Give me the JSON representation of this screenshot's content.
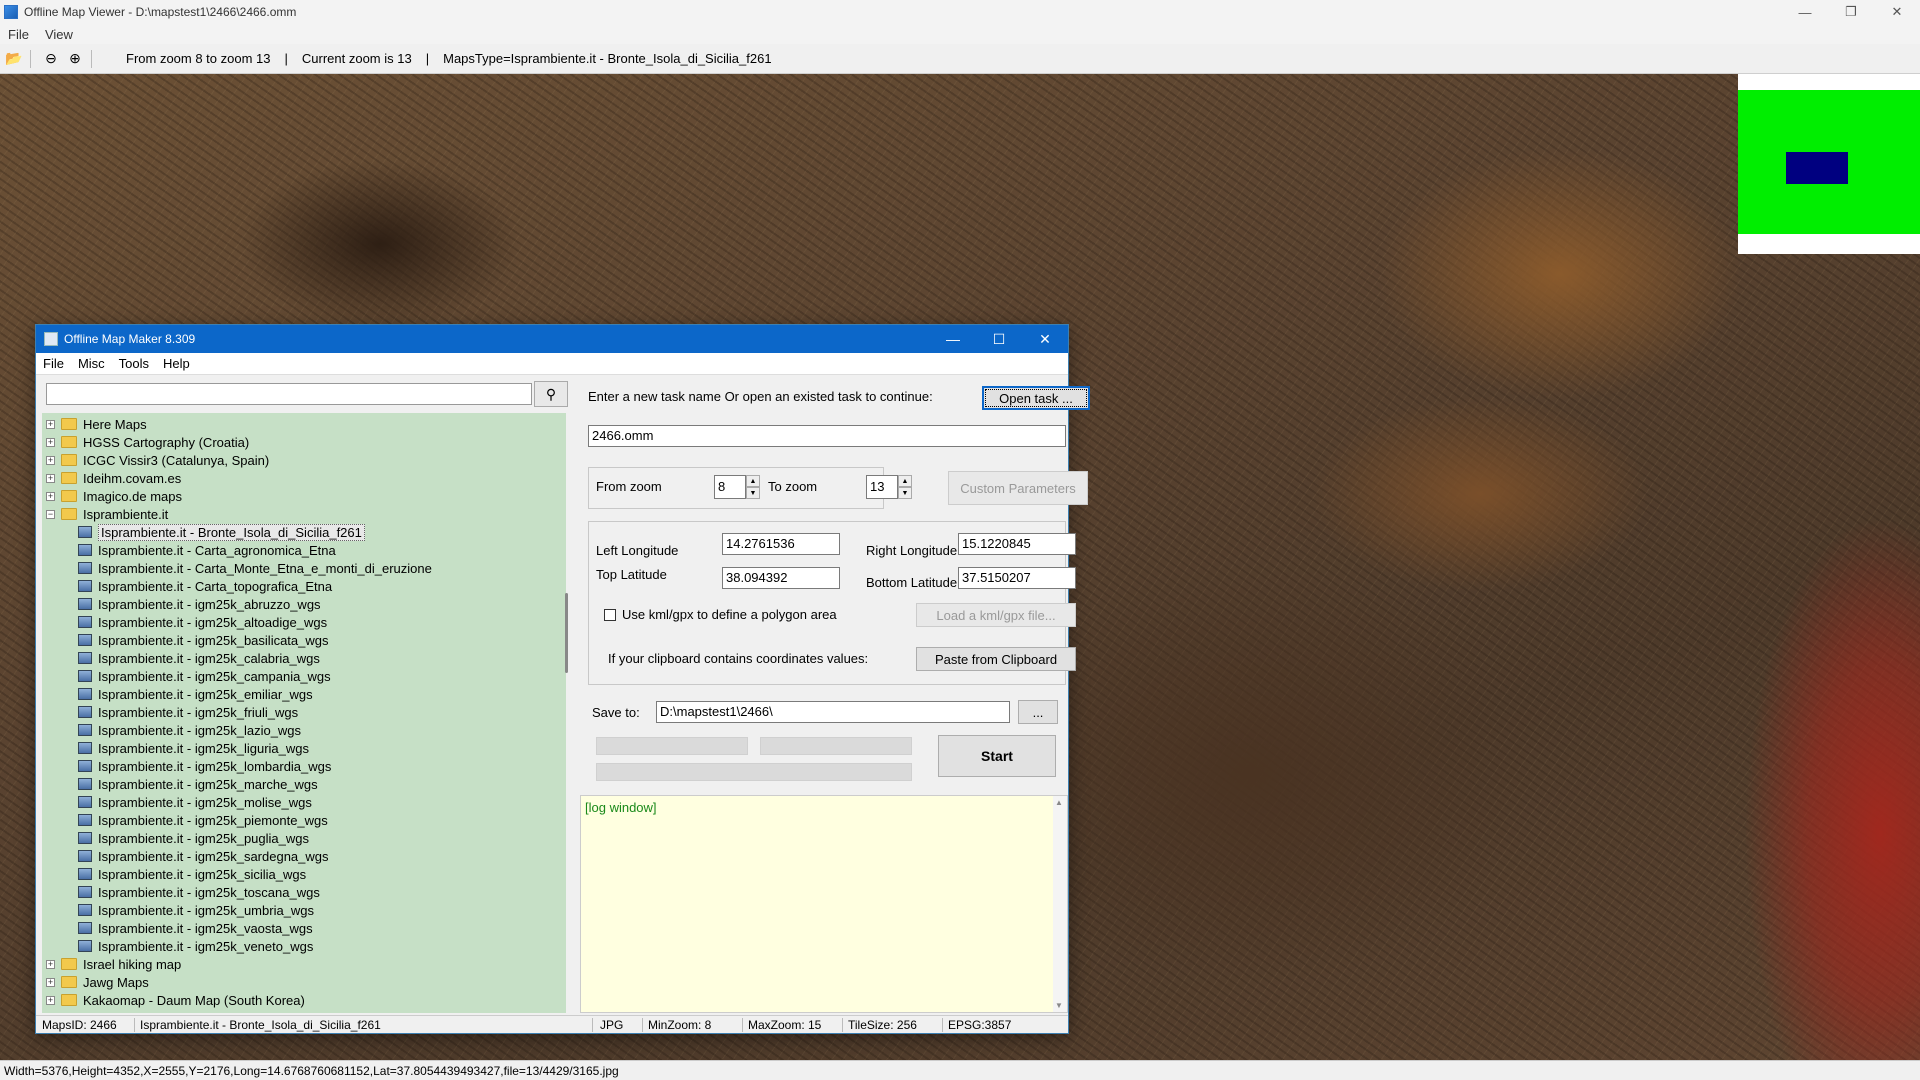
{
  "viewer": {
    "title": "Offline Map Viewer - D:\\mapstest1\\2466\\2466.omm",
    "menu": [
      "File",
      "View"
    ],
    "toolbar": {
      "zoom_range": "From zoom 8 to zoom 13",
      "current_zoom": "Current zoom is 13",
      "maps_type": "MapsType=Isprambiente.it - Bronte_Isola_di_Sicilia_f261",
      "sep": "|"
    },
    "status": "Width=5376,Height=4352,X=2555,Y=2176,Long=14.6768760681152,Lat=37.8054439493427,file=13/4429/3165.jpg"
  },
  "dialog": {
    "title": "Offline Map Maker 8.309",
    "menu": [
      "File",
      "Misc",
      "Tools",
      "Help"
    ],
    "search": {
      "value": "",
      "placeholder": ""
    },
    "tree": {
      "folders_before": [
        "Here Maps",
        "HGSS Cartography (Croatia)",
        "ICGC Vissir3 (Catalunya, Spain)",
        "Ideihm.covam.es",
        "Imagico.de maps"
      ],
      "open_folder": "Isprambiente.it",
      "children": [
        "Isprambiente.it - Bronte_Isola_di_Sicilia_f261",
        "Isprambiente.it - Carta_agronomica_Etna",
        "Isprambiente.it - Carta_Monte_Etna_e_monti_di_eruzione",
        "Isprambiente.it - Carta_topografica_Etna",
        "Isprambiente.it - igm25k_abruzzo_wgs",
        "Isprambiente.it - igm25k_altoadige_wgs",
        "Isprambiente.it - igm25k_basilicata_wgs",
        "Isprambiente.it - igm25k_calabria_wgs",
        "Isprambiente.it - igm25k_campania_wgs",
        "Isprambiente.it - igm25k_emiliar_wgs",
        "Isprambiente.it - igm25k_friuli_wgs",
        "Isprambiente.it - igm25k_lazio_wgs",
        "Isprambiente.it - igm25k_liguria_wgs",
        "Isprambiente.it - igm25k_lombardia_wgs",
        "Isprambiente.it - igm25k_marche_wgs",
        "Isprambiente.it - igm25k_molise_wgs",
        "Isprambiente.it - igm25k_piemonte_wgs",
        "Isprambiente.it - igm25k_puglia_wgs",
        "Isprambiente.it - igm25k_sardegna_wgs",
        "Isprambiente.it - igm25k_sicilia_wgs",
        "Isprambiente.it - igm25k_toscana_wgs",
        "Isprambiente.it - igm25k_umbria_wgs",
        "Isprambiente.it - igm25k_vaosta_wgs",
        "Isprambiente.it - igm25k_veneto_wgs"
      ],
      "folders_after": [
        "Israel hiking map",
        "Jawg Maps",
        "Kakaomap - Daum Map (South Korea)"
      ]
    },
    "task_prompt": "Enter a new task name Or open an existed task to continue:",
    "open_task": "Open task ...",
    "task_name": "2466.omm",
    "from_zoom_label": "From zoom",
    "from_zoom": "8",
    "to_zoom_label": "To zoom",
    "to_zoom": "13",
    "custom_params": "Custom Parameters",
    "left_lon_label": "Left Longitude",
    "left_lon": "14.2761536",
    "right_lon_label": "Right Longitude",
    "right_lon": "15.1220845",
    "top_lat_label": "Top Latitude",
    "top_lat": "38.094392",
    "bottom_lat_label": "Bottom Latitude",
    "bottom_lat": "37.5150207",
    "kml_label": "Use kml/gpx to define a polygon area",
    "load_kml": "Load a kml/gpx file...",
    "clipboard_label": "If your clipboard contains coordinates values:",
    "paste_clipboard": "Paste from Clipboard",
    "save_to_label": "Save to:",
    "save_to": "D:\\mapstest1\\2466\\",
    "browse": "...",
    "start": "Start",
    "log": "[log window]",
    "status": {
      "maps_id": "MapsID: 2466",
      "map_name": "Isprambiente.it - Bronte_Isola_di_Sicilia_f261",
      "format": "JPG",
      "min_zoom": "MinZoom: 8",
      "max_zoom": "MaxZoom: 15",
      "tile_size": "TileSize: 256",
      "epsg": "EPSG:3857"
    }
  }
}
